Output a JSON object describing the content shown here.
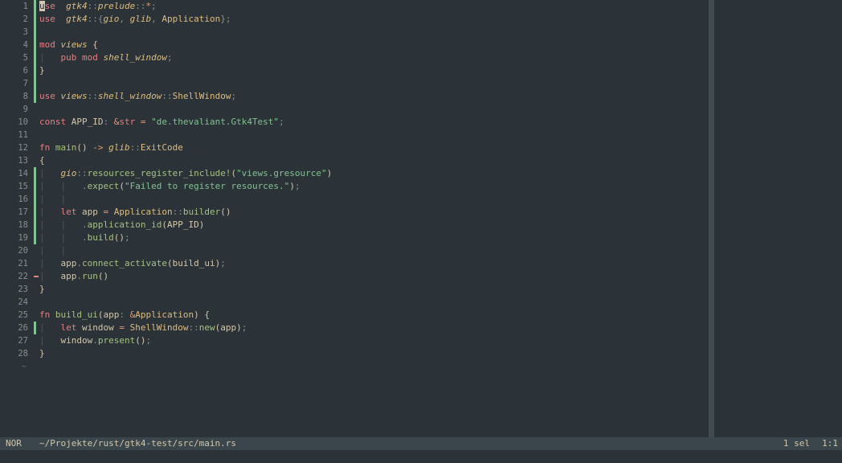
{
  "editor": {
    "lines": [
      {
        "n": "1",
        "git": "add",
        "segs": [
          [
            "kw",
            "u",
            "cursor"
          ],
          [
            "kw",
            "se"
          ],
          [
            "",
            "  "
          ],
          [
            "it",
            "gtk4"
          ],
          [
            "pu",
            "::"
          ],
          [
            "it",
            "prelude"
          ],
          [
            "pu",
            "::"
          ],
          [
            "op",
            "*"
          ],
          [
            "pu",
            ";"
          ]
        ]
      },
      {
        "n": "2",
        "git": "add",
        "segs": [
          [
            "kw",
            "use"
          ],
          [
            "",
            "  "
          ],
          [
            "it",
            "gtk4"
          ],
          [
            "pu",
            "::{"
          ],
          [
            "it",
            "gio"
          ],
          [
            "pu",
            ", "
          ],
          [
            "it",
            "glib"
          ],
          [
            "pu",
            ", "
          ],
          [
            "ty",
            "Application"
          ],
          [
            "pu",
            "};"
          ]
        ]
      },
      {
        "n": "3",
        "git": "add",
        "segs": []
      },
      {
        "n": "4",
        "git": "add",
        "segs": [
          [
            "kw",
            "mod"
          ],
          [
            "",
            " "
          ],
          [
            "it",
            "views"
          ],
          [
            "",
            " {"
          ]
        ]
      },
      {
        "n": "5",
        "git": "add",
        "segs": [
          [
            "guide",
            "|"
          ],
          [
            "",
            "   "
          ],
          [
            "kw",
            "pub mod"
          ],
          [
            "",
            " "
          ],
          [
            "it",
            "shell_window"
          ],
          [
            "pu",
            ";"
          ]
        ]
      },
      {
        "n": "6",
        "git": "add",
        "segs": [
          [
            "",
            "}"
          ]
        ]
      },
      {
        "n": "7",
        "git": "add",
        "segs": []
      },
      {
        "n": "8",
        "git": "add",
        "segs": [
          [
            "kw",
            "use"
          ],
          [
            "",
            " "
          ],
          [
            "it",
            "views"
          ],
          [
            "pu",
            "::"
          ],
          [
            "it",
            "shell_window"
          ],
          [
            "pu",
            "::"
          ],
          [
            "ty",
            "ShellWindow"
          ],
          [
            "pu",
            ";"
          ]
        ]
      },
      {
        "n": "9",
        "git": "",
        "segs": []
      },
      {
        "n": "10",
        "git": "",
        "segs": [
          [
            "kw",
            "const"
          ],
          [
            "",
            " APP_ID"
          ],
          [
            "pu",
            ":"
          ],
          [
            "",
            " "
          ],
          [
            "op",
            "&"
          ],
          [
            "kw",
            "str"
          ],
          [
            "",
            " "
          ],
          [
            "op",
            "="
          ],
          [
            "",
            " "
          ],
          [
            "str",
            "\"de.thevaliant.Gtk4Test\""
          ],
          [
            "pu",
            ";"
          ]
        ]
      },
      {
        "n": "11",
        "git": "",
        "segs": []
      },
      {
        "n": "12",
        "git": "",
        "segs": [
          [
            "kw",
            "fn"
          ],
          [
            "",
            " "
          ],
          [
            "fn",
            "main"
          ],
          [
            "",
            "() "
          ],
          [
            "op",
            "->"
          ],
          [
            "",
            " "
          ],
          [
            "it",
            "glib"
          ],
          [
            "pu",
            "::"
          ],
          [
            "ty",
            "ExitCode"
          ]
        ]
      },
      {
        "n": "13",
        "git": "",
        "segs": [
          [
            "",
            "{"
          ]
        ]
      },
      {
        "n": "14",
        "git": "add",
        "segs": [
          [
            "guide",
            "|"
          ],
          [
            "",
            "   "
          ],
          [
            "it",
            "gio"
          ],
          [
            "pu",
            "::"
          ],
          [
            "fn",
            "resources_register_include!"
          ],
          [
            "",
            "("
          ],
          [
            "str",
            "\"views.gresource\""
          ],
          [
            "",
            ")"
          ]
        ]
      },
      {
        "n": "15",
        "git": "add",
        "segs": [
          [
            "guide",
            "|   |"
          ],
          [
            "",
            "   "
          ],
          [
            "pu",
            "."
          ],
          [
            "fn",
            "expect"
          ],
          [
            "",
            "("
          ],
          [
            "str",
            "\"Failed to register resources.\""
          ],
          [
            "",
            ")"
          ],
          [
            "pu",
            ";"
          ]
        ]
      },
      {
        "n": "16",
        "git": "add",
        "segs": [
          [
            "guide",
            "|   |"
          ]
        ]
      },
      {
        "n": "17",
        "git": "add",
        "segs": [
          [
            "guide",
            "|"
          ],
          [
            "",
            "   "
          ],
          [
            "kw",
            "let"
          ],
          [
            "",
            " app "
          ],
          [
            "op",
            "="
          ],
          [
            "",
            " "
          ],
          [
            "ty",
            "Application"
          ],
          [
            "pu",
            "::"
          ],
          [
            "fn",
            "builder"
          ],
          [
            "",
            "()"
          ]
        ]
      },
      {
        "n": "18",
        "git": "add",
        "segs": [
          [
            "guide",
            "|   |"
          ],
          [
            "",
            "   "
          ],
          [
            "pu",
            "."
          ],
          [
            "fn",
            "application_id"
          ],
          [
            "",
            "(APP_ID)"
          ]
        ]
      },
      {
        "n": "19",
        "git": "add",
        "segs": [
          [
            "guide",
            "|   |"
          ],
          [
            "",
            "   "
          ],
          [
            "pu",
            "."
          ],
          [
            "fn",
            "build"
          ],
          [
            "",
            "()"
          ],
          [
            "pu",
            ";"
          ]
        ]
      },
      {
        "n": "20",
        "git": "",
        "segs": [
          [
            "guide",
            "|   |"
          ]
        ]
      },
      {
        "n": "21",
        "git": "",
        "segs": [
          [
            "guide",
            "|"
          ],
          [
            "",
            "   app"
          ],
          [
            "pu",
            "."
          ],
          [
            "fn",
            "connect_activate"
          ],
          [
            "",
            "(build_ui)"
          ],
          [
            "pu",
            ";"
          ]
        ]
      },
      {
        "n": "22",
        "git": "del",
        "segs": [
          [
            "guide",
            "|"
          ],
          [
            "",
            "   app"
          ],
          [
            "pu",
            "."
          ],
          [
            "fn",
            "run"
          ],
          [
            "",
            "()"
          ]
        ]
      },
      {
        "n": "23",
        "git": "",
        "segs": [
          [
            "",
            "}"
          ]
        ]
      },
      {
        "n": "24",
        "git": "",
        "segs": []
      },
      {
        "n": "25",
        "git": "",
        "segs": [
          [
            "kw",
            "fn"
          ],
          [
            "",
            " "
          ],
          [
            "fn",
            "build_ui"
          ],
          [
            "",
            "(app"
          ],
          [
            "pu",
            ":"
          ],
          [
            "",
            " "
          ],
          [
            "op",
            "&"
          ],
          [
            "ty",
            "Application"
          ],
          [
            "",
            ") {"
          ]
        ]
      },
      {
        "n": "26",
        "git": "add",
        "segs": [
          [
            "guide",
            "|"
          ],
          [
            "",
            "   "
          ],
          [
            "kw",
            "let"
          ],
          [
            "",
            " window "
          ],
          [
            "op",
            "="
          ],
          [
            "",
            " "
          ],
          [
            "ty",
            "ShellWindow"
          ],
          [
            "pu",
            "::"
          ],
          [
            "fn",
            "new"
          ],
          [
            "",
            "(app)"
          ],
          [
            "pu",
            ";"
          ]
        ]
      },
      {
        "n": "27",
        "git": "",
        "segs": [
          [
            "guide",
            "|"
          ],
          [
            "",
            "   window"
          ],
          [
            "pu",
            "."
          ],
          [
            "fn",
            "present"
          ],
          [
            "",
            "()"
          ],
          [
            "pu",
            ";"
          ]
        ]
      },
      {
        "n": "28",
        "git": "",
        "segs": [
          [
            "",
            "}"
          ]
        ]
      }
    ],
    "eof_marker": "~"
  },
  "statusline": {
    "mode": "NOR",
    "file_path": "~/Projekte/rust/gtk4-test/src/main.rs",
    "selection": "1 sel",
    "position": "1:1"
  },
  "colors": {
    "background": "#2b3339",
    "foreground": "#d3c6aa",
    "keyword": "#e67e80",
    "type": "#dbbc7f",
    "function": "#a7c080",
    "string": "#83c092",
    "git_added": "#83c092",
    "git_deleted": "#e67e80"
  }
}
